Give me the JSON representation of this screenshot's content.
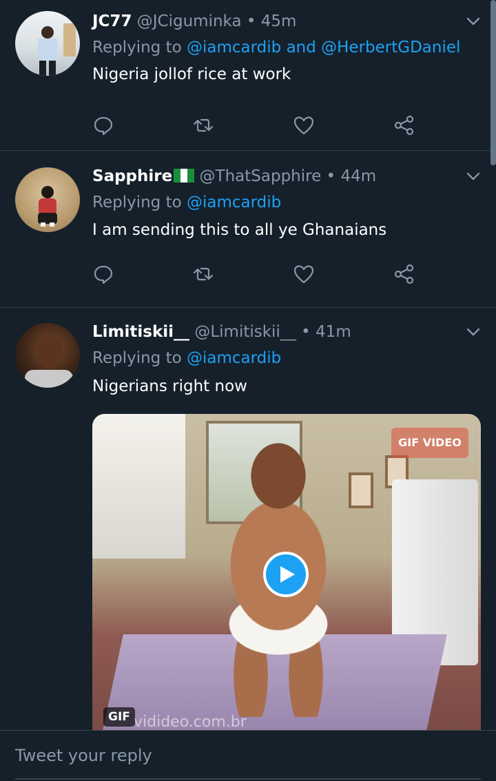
{
  "tweets": [
    {
      "name": "JC77",
      "handle": "@JCiguminka",
      "dot": "•",
      "time": "45m",
      "replying_prefix": "Replying to",
      "replying_mentions": "@iamcardib and @HerbertGDaniel",
      "text": "Nigeria jollof rice at work"
    },
    {
      "name": "Sapphire",
      "handle": "@ThatSapphire",
      "dot": "•",
      "time": "44m",
      "replying_prefix": "Replying to",
      "replying_mentions": "@iamcardib",
      "text": "I am sending this to all ye Ghanaians"
    },
    {
      "name": "Limitiskii__",
      "handle": "@Limitiskii__",
      "dot": "•",
      "time": "41m",
      "replying_prefix": "Replying to",
      "replying_mentions": "@iamcardib",
      "text": "Nigerians right now",
      "media": {
        "badge": "GIF",
        "watermark_top": "GIF VIDEO",
        "watermark_bottom": "vidideo.com.br"
      }
    }
  ],
  "composer": {
    "placeholder": "Tweet your reply"
  },
  "colors": {
    "background": "#15202b",
    "link": "#1da1f2",
    "secondary": "#8899a6"
  },
  "icons": [
    "reply-icon",
    "retweet-icon",
    "like-icon",
    "share-icon",
    "chevron-down-icon",
    "play-icon"
  ]
}
